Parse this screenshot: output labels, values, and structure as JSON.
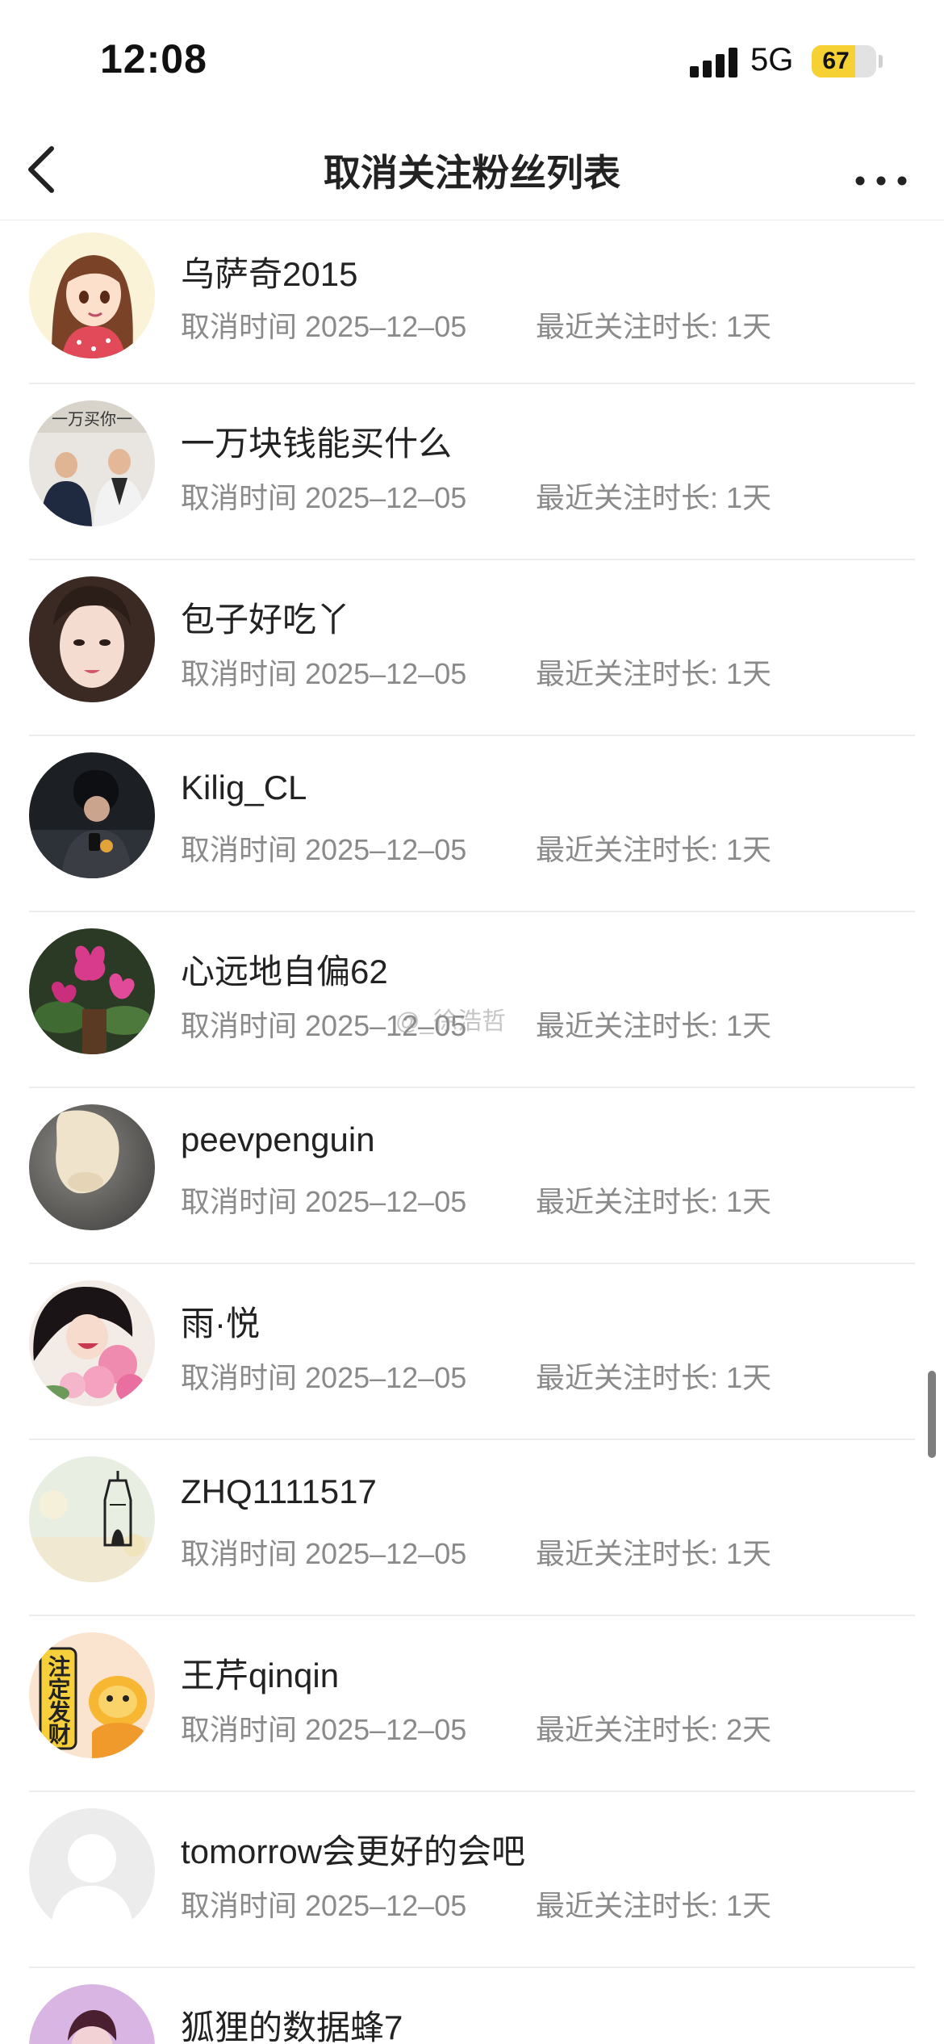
{
  "status_bar": {
    "time": "12:08",
    "network": "5G",
    "battery": "67",
    "battery_level": 0.67
  },
  "nav": {
    "title": "取消关注粉丝列表",
    "back_icon": "chevron-left-icon",
    "more_icon": "more-horizontal-icon"
  },
  "list": {
    "unfollow_label": "取消时间",
    "duration_label": "最近关注时长:",
    "items": [
      {
        "name": "乌萨奇2015",
        "date": "2025–12–05",
        "duration": "1天"
      },
      {
        "name": "一万块钱能买什么",
        "date": "2025–12–05",
        "duration": "1天"
      },
      {
        "name": "包子好吃丫",
        "date": "2025–12–05",
        "duration": "1天"
      },
      {
        "name": "Kilig_CL",
        "date": "2025–12–05",
        "duration": "1天"
      },
      {
        "name": "心远地自偏62",
        "date": "2025–12–05",
        "duration": "1天"
      },
      {
        "name": "peevpenguin",
        "date": "2025–12–05",
        "duration": "1天"
      },
      {
        "name": "雨·悦",
        "date": "2025–12–05",
        "duration": "1天"
      },
      {
        "name": "ZHQ1111517",
        "date": "2025–12–05",
        "duration": "1天"
      },
      {
        "name": "王芹qinqin",
        "date": "2025–12–05",
        "duration": "2天"
      },
      {
        "name": "tomorrow会更好的会吧",
        "date": "2025–12–05",
        "duration": "1天"
      },
      {
        "name": "狐狸的数据蜂7",
        "date": "",
        "duration": ""
      }
    ]
  },
  "avatars": {
    "a2_text": "一万买你一",
    "a9_text": "注定发财"
  },
  "watermark": "@_徐浩哲"
}
